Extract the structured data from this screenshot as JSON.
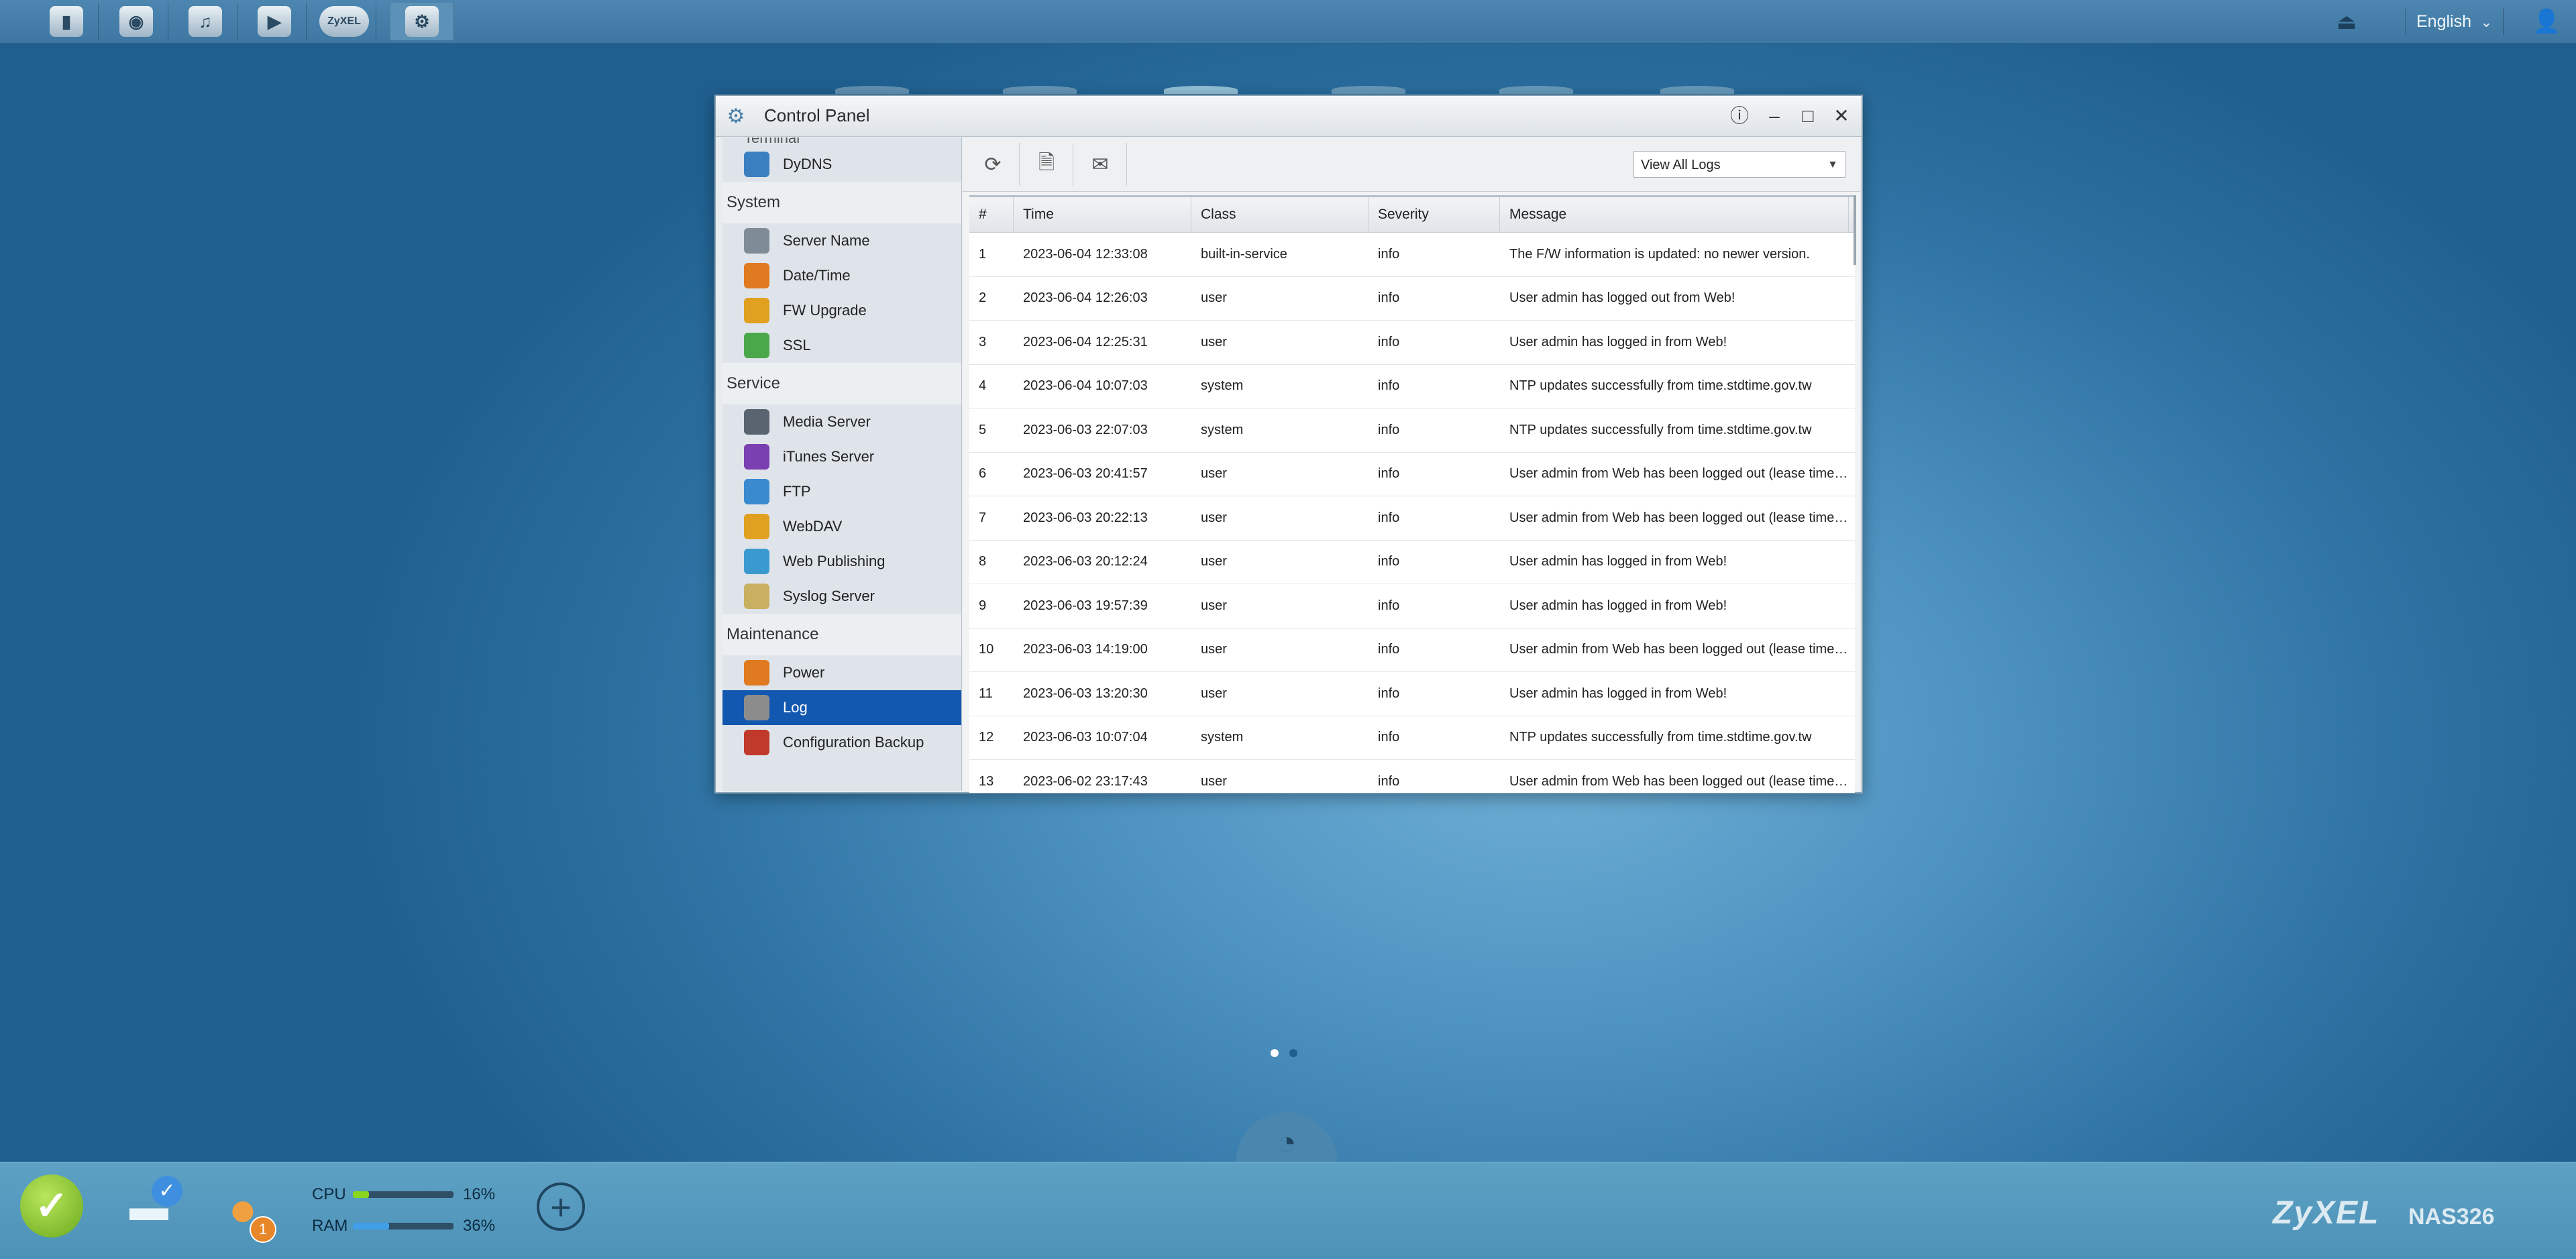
{
  "topbar": {
    "apps": [
      {
        "name": "file-browser",
        "glyph": "▮"
      },
      {
        "name": "photo-app",
        "glyph": "◉"
      },
      {
        "name": "music-app",
        "glyph": "♫"
      },
      {
        "name": "video-app",
        "glyph": "▶"
      },
      {
        "name": "zyxel-cloud",
        "glyph": "ZyXEL"
      },
      {
        "name": "control-panel",
        "glyph": "⚙"
      }
    ],
    "language": "English"
  },
  "window": {
    "title": "Control Panel"
  },
  "sidebar": {
    "partial_item": "Terminal",
    "sections": [
      {
        "items": [
          {
            "label": "DyDNS",
            "color": "#3a7fc0"
          }
        ]
      },
      {
        "heading": "System",
        "items": [
          {
            "label": "Server Name",
            "color": "#7f8c98"
          },
          {
            "label": "Date/Time",
            "color": "#e07a20"
          },
          {
            "label": "FW Upgrade",
            "color": "#e0a020"
          },
          {
            "label": "SSL",
            "color": "#4aa84a"
          }
        ]
      },
      {
        "heading": "Service",
        "items": [
          {
            "label": "Media Server",
            "color": "#5a6470"
          },
          {
            "label": "iTunes Server",
            "color": "#7a3fb0"
          },
          {
            "label": "FTP",
            "color": "#3a8ad0"
          },
          {
            "label": "WebDAV",
            "color": "#e0a020"
          },
          {
            "label": "Web Publishing",
            "color": "#3a9ad0"
          },
          {
            "label": "Syslog Server",
            "color": "#c8b060"
          }
        ]
      },
      {
        "heading": "Maintenance",
        "items": [
          {
            "label": "Power",
            "color": "#e07a20"
          },
          {
            "label": "Log",
            "color": "#8c8c8c",
            "selected": true
          },
          {
            "label": "Configuration Backup",
            "color": "#c0392b"
          }
        ]
      }
    ]
  },
  "toolbar": {
    "filter_value": "View All Logs"
  },
  "table": {
    "columns": [
      "#",
      "Time",
      "Class",
      "Severity",
      "Message"
    ],
    "rows": [
      [
        "1",
        "2023-06-04 12:33:08",
        "built-in-service",
        "info",
        "The F/W information is updated: no newer version."
      ],
      [
        "2",
        "2023-06-04 12:26:03",
        "user",
        "info",
        "User admin has logged out from Web!"
      ],
      [
        "3",
        "2023-06-04 12:25:31",
        "user",
        "info",
        "User admin has logged in from Web!"
      ],
      [
        "4",
        "2023-06-04 10:07:03",
        "system",
        "info",
        "NTP updates successfully from time.stdtime.gov.tw"
      ],
      [
        "5",
        "2023-06-03 22:07:03",
        "system",
        "info",
        "NTP updates successfully from time.stdtime.gov.tw"
      ],
      [
        "6",
        "2023-06-03 20:41:57",
        "user",
        "info",
        "User admin from Web has been logged out (lease time…"
      ],
      [
        "7",
        "2023-06-03 20:22:13",
        "user",
        "info",
        "User admin from Web has been logged out (lease time…"
      ],
      [
        "8",
        "2023-06-03 20:12:24",
        "user",
        "info",
        "User admin has logged in from Web!"
      ],
      [
        "9",
        "2023-06-03 19:57:39",
        "user",
        "info",
        "User admin has logged in from Web!"
      ],
      [
        "10",
        "2023-06-03 14:19:00",
        "user",
        "info",
        "User admin from Web has been logged out (lease time…"
      ],
      [
        "11",
        "2023-06-03 13:20:30",
        "user",
        "info",
        "User admin has logged in from Web!"
      ],
      [
        "12",
        "2023-06-03 10:07:04",
        "system",
        "info",
        "NTP updates successfully from time.stdtime.gov.tw"
      ],
      [
        "13",
        "2023-06-02 23:17:43",
        "user",
        "info",
        "User admin from Web has been logged out (lease time…"
      ]
    ]
  },
  "status": {
    "cpu_label": "CPU",
    "cpu_value": "16%",
    "cpu_fraction": 0.16,
    "cpu_color": "#8bd61e",
    "ram_label": "RAM",
    "ram_value": "36%",
    "ram_fraction": 0.36,
    "ram_color": "#3fa0e8",
    "user_badge": "1"
  },
  "branding": {
    "brand": "ZyXEL",
    "model": "NAS326"
  }
}
